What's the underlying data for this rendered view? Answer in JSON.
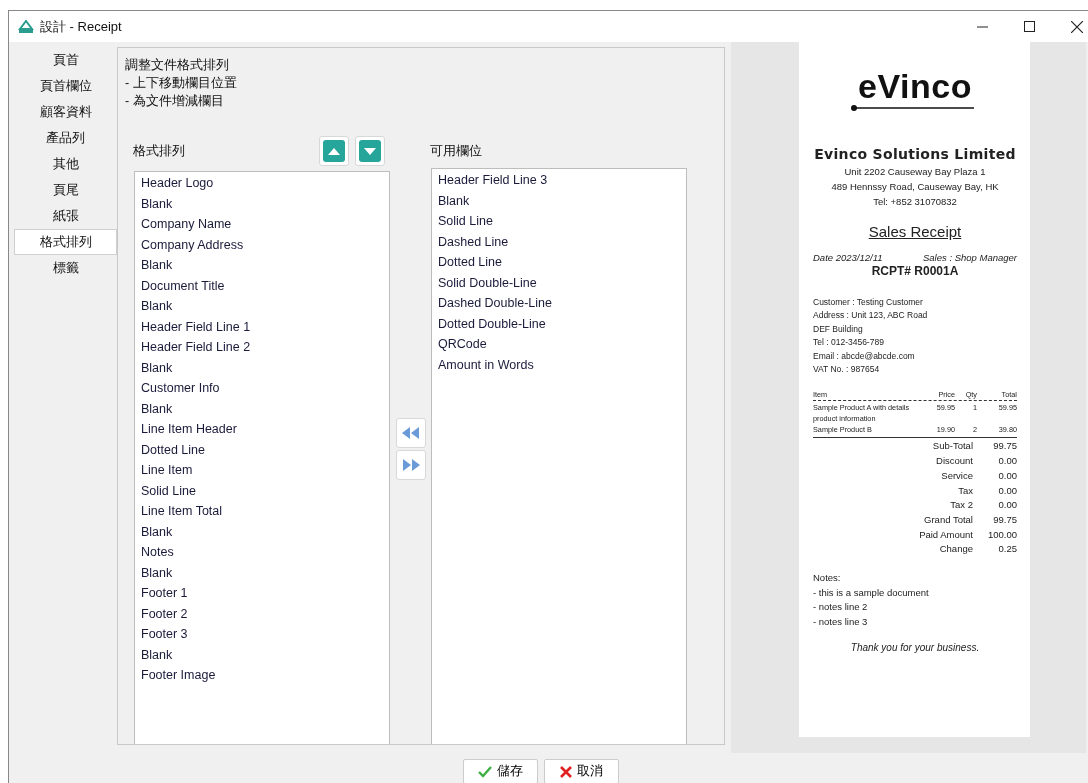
{
  "window": {
    "title": "設計 - Receipt"
  },
  "sidebar": {
    "items": [
      {
        "label": "頁首",
        "selected": false
      },
      {
        "label": "頁首欄位",
        "selected": false
      },
      {
        "label": "顧客資料",
        "selected": false
      },
      {
        "label": "產品列",
        "selected": false
      },
      {
        "label": "其他",
        "selected": false
      },
      {
        "label": "頁尾",
        "selected": false
      },
      {
        "label": "紙張",
        "selected": false
      },
      {
        "label": "格式排列",
        "selected": true
      },
      {
        "label": "標籤",
        "selected": false
      }
    ]
  },
  "instructions": [
    "調整文件格式排列",
    "- 上下移動欄目位置",
    "- 為文件增減欄目"
  ],
  "layout_list": {
    "label": "格式排列",
    "items": [
      {
        "label": "Header Logo",
        "selected": false
      },
      {
        "label": "Blank",
        "selected": false
      },
      {
        "label": "Company Name",
        "selected": false
      },
      {
        "label": "Company Address",
        "selected": false
      },
      {
        "label": "Blank",
        "selected": false
      },
      {
        "label": "Document Title",
        "selected": false
      },
      {
        "label": "Blank",
        "selected": false
      },
      {
        "label": "Header Field Line 1",
        "selected": false
      },
      {
        "label": "Header Field Line 2",
        "selected": false
      },
      {
        "label": "Blank",
        "selected": false
      },
      {
        "label": "Customer Info",
        "selected": false
      },
      {
        "label": "Blank",
        "selected": false
      },
      {
        "label": "Line Item Header",
        "selected": false
      },
      {
        "label": "Dotted Line",
        "selected": false
      },
      {
        "label": "Line Item",
        "selected": false
      },
      {
        "label": "Solid Line",
        "selected": false
      },
      {
        "label": "Line Item Total",
        "selected": false
      },
      {
        "label": "Blank",
        "selected": false
      },
      {
        "label": "Notes",
        "selected": false
      },
      {
        "label": "Blank",
        "selected": false
      },
      {
        "label": "Footer 1",
        "selected": false
      },
      {
        "label": "Footer 2",
        "selected": false
      },
      {
        "label": "Footer 3",
        "selected": false
      },
      {
        "label": "Blank",
        "selected": false
      },
      {
        "label": "Footer Image",
        "selected": false
      }
    ]
  },
  "available_list": {
    "label": "可用欄位",
    "items": [
      {
        "label": "Header Field Line 3",
        "selected": false
      },
      {
        "label": "Blank",
        "selected": false
      },
      {
        "label": "Solid Line",
        "selected": false
      },
      {
        "label": "Dashed Line",
        "selected": false
      },
      {
        "label": "Dotted Line",
        "selected": false
      },
      {
        "label": "Solid Double-Line",
        "selected": false
      },
      {
        "label": "Dashed Double-Line",
        "selected": false
      },
      {
        "label": "Dotted Double-Line",
        "selected": false
      },
      {
        "label": "QRCode",
        "selected": false
      },
      {
        "label": "Amount in Words",
        "selected": false
      }
    ]
  },
  "receipt": {
    "logo_text": "eVinco",
    "company_name": "Evinco Solutions Limited",
    "address_lines": [
      "Unit 2202 Causeway Bay Plaza 1",
      "489 Hennssy Road, Causeway Bay, HK",
      "Tel: +852 31070832"
    ],
    "title": "Sales Receipt",
    "date": "Date 2023/12/11",
    "sales": "Sales : Shop Manager",
    "receipt_no": "RCPT# R0001A",
    "customer_lines": [
      "Customer : Testing Customer",
      "Address : Unit 123, ABC Road",
      "DEF Building",
      "Tel : 012-3456-789",
      "Email : abcde@abcde.com",
      "VAT No. : 987654"
    ],
    "item_columns": [
      "Item",
      "Price",
      "Qty",
      "Total"
    ],
    "items": [
      {
        "name": "Sample Product A with details product information",
        "price": "59.95",
        "qty": "1",
        "total": "59.95"
      },
      {
        "name": "Sample Product B",
        "price": "19.90",
        "qty": "2",
        "total": "39.80"
      }
    ],
    "totals": [
      {
        "label": "Sub-Total",
        "value": "99.75"
      },
      {
        "label": "Discount",
        "value": "0.00"
      },
      {
        "label": "Service",
        "value": "0.00"
      },
      {
        "label": "Tax",
        "value": "0.00"
      },
      {
        "label": "Tax 2",
        "value": "0.00"
      },
      {
        "label": "Grand Total",
        "value": "99.75"
      },
      {
        "label": "Paid Amount",
        "value": "100.00"
      },
      {
        "label": "Change",
        "value": "0.25"
      }
    ],
    "notes": [
      "Notes:",
      "- this is a sample document",
      "- notes line 2",
      "- notes line 3"
    ],
    "thanks": "Thank you for your business."
  },
  "buttons": [
    {
      "label": "儲存",
      "kind": "save"
    },
    {
      "label": "取消",
      "kind": "cancel"
    }
  ]
}
